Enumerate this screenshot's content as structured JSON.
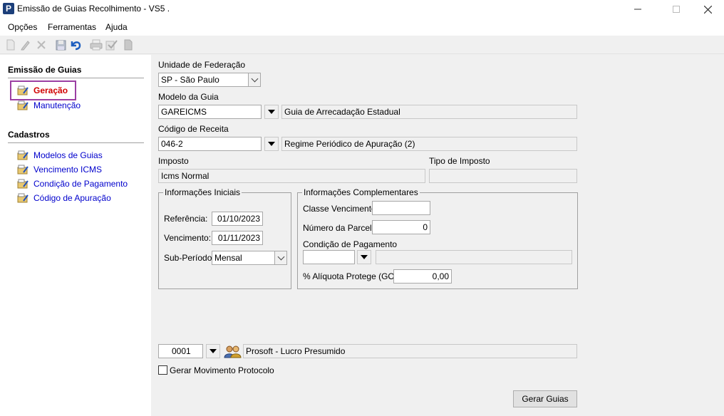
{
  "window": {
    "title": "Emissão de Guias Recolhimento - VS5  .",
    "app_icon_letter": "P"
  },
  "menu": {
    "items": [
      {
        "label": "Opções"
      },
      {
        "label": "Ferramentas"
      },
      {
        "label": "Ajuda"
      }
    ]
  },
  "toolbar": {
    "icons": [
      "new-icon",
      "edit-icon",
      "delete-icon",
      "save-icon",
      "undo-icon",
      "print-icon",
      "check-icon",
      "document-icon"
    ]
  },
  "sidebar": {
    "section1_title": "Emissão de Guias",
    "section1_items": [
      {
        "label": "Geração"
      },
      {
        "label": "Manutenção"
      }
    ],
    "section2_title": "Cadastros",
    "section2_items": [
      {
        "label": "Modelos de Guias"
      },
      {
        "label": "Vencimento ICMS"
      },
      {
        "label": "Condição de Pagamento"
      },
      {
        "label": "Código de Apuração"
      }
    ],
    "selected_color": "#d00000",
    "link_color": "#0000cc"
  },
  "form": {
    "uf_label": "Unidade de Federação",
    "uf_value": "SP - São Paulo",
    "modelo_label": "Modelo da Guia",
    "modelo_code": "GAREICMS",
    "modelo_desc": "Guia de Arrecadação Estadual",
    "codigo_label": "Código de Receita",
    "codigo_code": "046-2",
    "codigo_desc": "Regime Periódico de Apuração (2)",
    "imposto_label": "Imposto",
    "imposto_value": "Icms Normal",
    "tipo_label": "Tipo de Imposto",
    "tipo_value": "",
    "info_iniciais": {
      "title": "Informações Iniciais",
      "referencia_label": "Referência:",
      "referencia_value": "01/10/2023",
      "vencimento_label": "Vencimento:",
      "vencimento_value": "01/11/2023",
      "subperiodo_label": "Sub-Período:",
      "subperiodo_value": "Mensal"
    },
    "info_complementares": {
      "title": "Informações Complementares",
      "classe_label": "Classe Vencimento:",
      "classe_value": "",
      "parcela_label": "Número da Parcela:",
      "parcela_value": "0",
      "condicao_label": "Condição de Pagamento",
      "condicao_code": "",
      "condicao_desc": "",
      "aliquota_label": "% Alíquota Protege (GO):",
      "aliquota_value": "0,00"
    },
    "empresa_code": "0001",
    "empresa_name": "Prosoft - Lucro Presumido",
    "gerar_protocolo_label": "Gerar Movimento Protocolo",
    "gerar_protocolo_checked": false,
    "gerar_button": "Gerar Guias"
  }
}
